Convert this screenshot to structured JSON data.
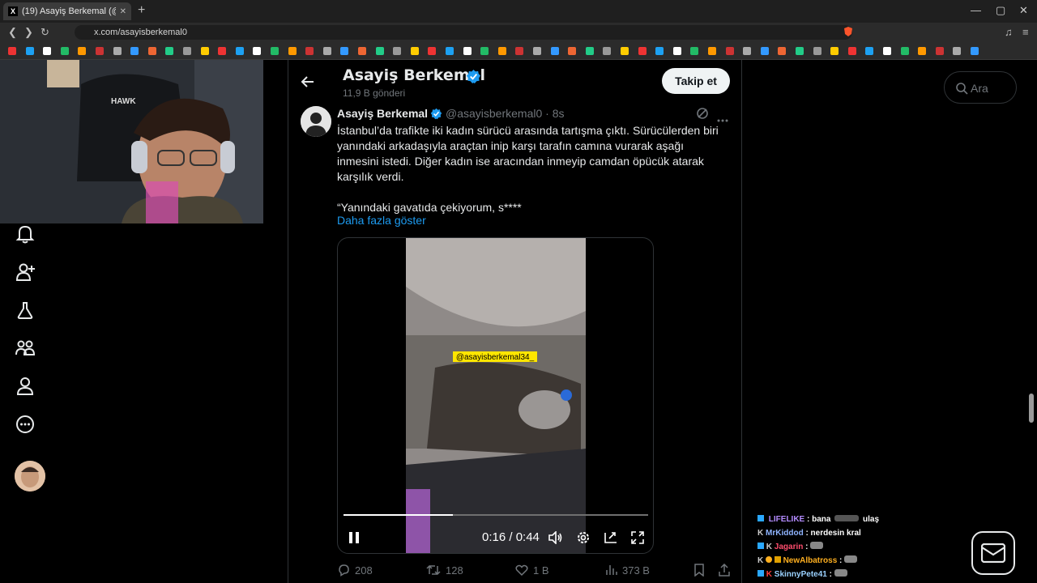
{
  "browser": {
    "tab_title": "(19) Asayiş Berkemal (@asayi",
    "tab_logo": "X",
    "new_tab": "+",
    "url": "x.com/asayisberkemal0",
    "window_controls": [
      "—",
      "▢",
      "✕"
    ]
  },
  "profile": {
    "name": "Asayiş Berkemal",
    "post_count": "11,9 B gönderi",
    "follow_label": "Takip et",
    "verified_color": "#1d9bf0"
  },
  "tweet": {
    "name": "Asayiş Berkemal",
    "handle_time": "@asayisberkemal0 · 8s",
    "text": "İstanbul’da trafikte iki kadın sürücü arasında tartışma çıktı. Sürücülerden biri yanındaki arkadaşıyla araçtan inip karşı tarafın camına vurarak aşağı inmesini istedi. Diğer kadın ise aracından inmeyip camdan öpücük atarak karşılık verdi.",
    "quote": "“Yanındaki gavatıda çekiyorum, s****",
    "show_more": "Daha fazla göster",
    "video": {
      "watermark": "@asayisberkemal34_",
      "time": "0:16 / 0:44",
      "progress": 0.36
    },
    "stats": {
      "replies": "208",
      "reposts": "128",
      "likes": "1 B",
      "views": "373 B"
    }
  },
  "search": {
    "placeholder": "Ara"
  },
  "chat": [
    {
      "user": "LIFELIKE",
      "text": ": bana",
      "tail": "ulaş",
      "color": "#b48cff"
    },
    {
      "user": "MrKiddod",
      "text": ": nerdesin kral",
      "color": "#8fb4ff"
    },
    {
      "user": "Jagarin",
      "text": ":",
      "color": "#ff4d6d"
    },
    {
      "user": "NewAlbatross",
      "text": ":",
      "color": "#ffb020"
    },
    {
      "user": "SkinnyPete41",
      "text": ":",
      "color": "#9ad1ff"
    }
  ]
}
